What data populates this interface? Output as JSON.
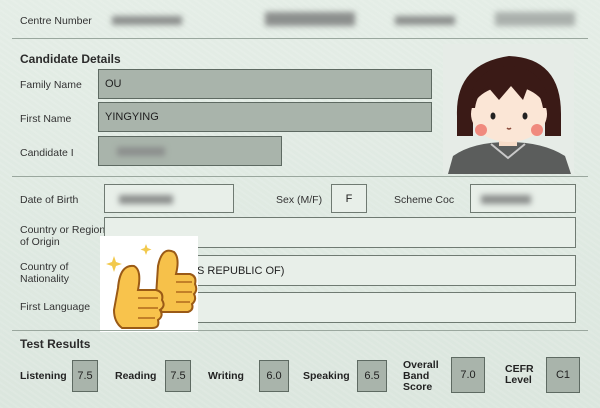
{
  "header": {
    "centre_number_label": "Centre Number"
  },
  "candidate_details": {
    "heading": "Candidate Details",
    "family_name_label": "Family Name",
    "family_name_value": "OU",
    "first_name_label": "First Name",
    "first_name_value": "YINGYING",
    "candidate_id_label": "Candidate I"
  },
  "personal": {
    "dob_label": "Date of Birth",
    "sex_label": "Sex (M/F)",
    "sex_value": "F",
    "scheme_label": "Scheme Coc",
    "country_region_label_1": "Country or Region",
    "country_region_label_2": "of Origin",
    "nationality_label_1": "Country of",
    "nationality_label_2": "Nationality",
    "nationality_value_fragment": "S REPUBLIC OF)",
    "first_language_label": "First Language"
  },
  "results": {
    "heading": "Test Results",
    "listening_label": "Listening",
    "listening_value": "7.5",
    "reading_label": "Reading",
    "reading_value": "7.5",
    "writing_label": "Writing",
    "writing_value": "6.0",
    "speaking_label": "Speaking",
    "speaking_value": "6.5",
    "overall_label_1": "Overall",
    "overall_label_2": "Band",
    "overall_label_3": "Score",
    "overall_value": "7.0",
    "cefr_label_1": "CEFR",
    "cefr_label_2": "Level",
    "cefr_value": "C1"
  },
  "icons": {
    "photo": "cartoon-girl-avatar",
    "sticker": "thumbs-up-emoji"
  }
}
